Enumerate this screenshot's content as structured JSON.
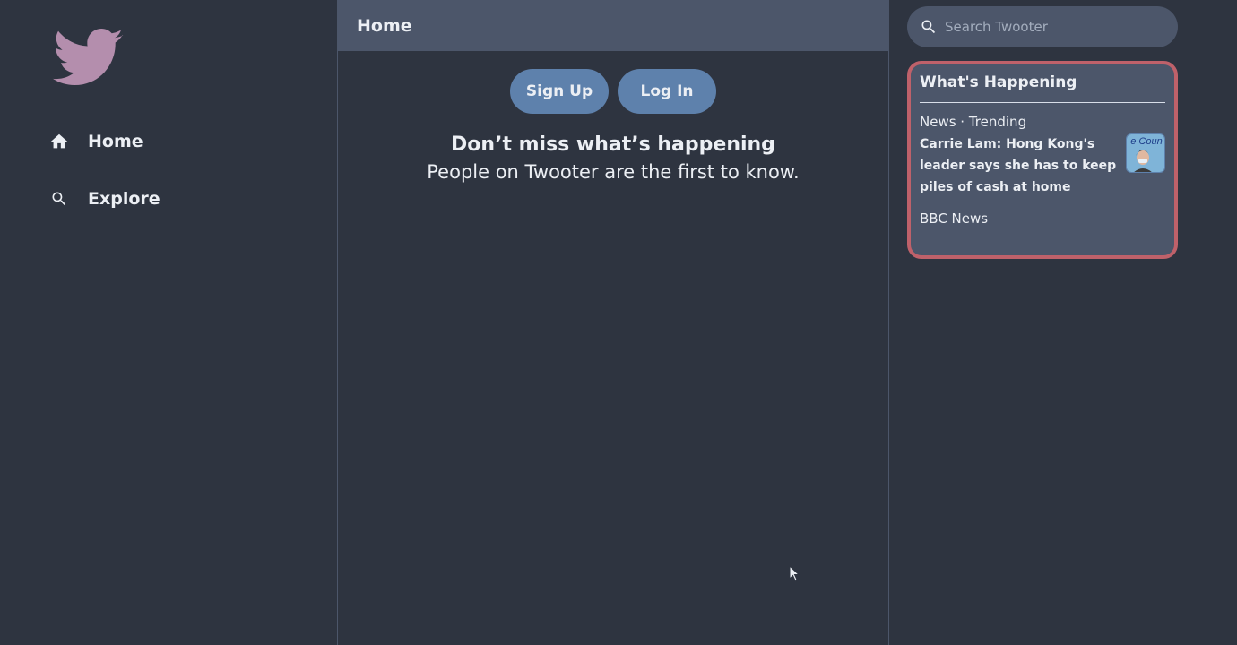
{
  "brand": {
    "logo_icon": "bird-logo-icon",
    "logo_color": "#b48ead"
  },
  "sidebar": {
    "items": [
      {
        "label": "Home",
        "icon": "home-icon"
      },
      {
        "label": "Explore",
        "icon": "search-icon"
      }
    ]
  },
  "main": {
    "title": "Home",
    "signup_label": "Sign Up",
    "login_label": "Log In",
    "headline": "Don’t miss what’s happening",
    "subline": "People on Twooter are the first to know."
  },
  "search": {
    "placeholder": "Search Twooter",
    "value": ""
  },
  "happening": {
    "title": "What's Happening",
    "trends": [
      {
        "meta": "News · Trending",
        "headline": "Carrie Lam: Hong Kong's leader says she has to keep piles of cash at home",
        "source": "BBC News",
        "thumb_text": "e Coun"
      }
    ]
  },
  "colors": {
    "background": "#2e3440",
    "panel": "#4c566a",
    "accent_button": "#5e81ac",
    "card_border": "#bf616a",
    "text": "#eceff4"
  }
}
